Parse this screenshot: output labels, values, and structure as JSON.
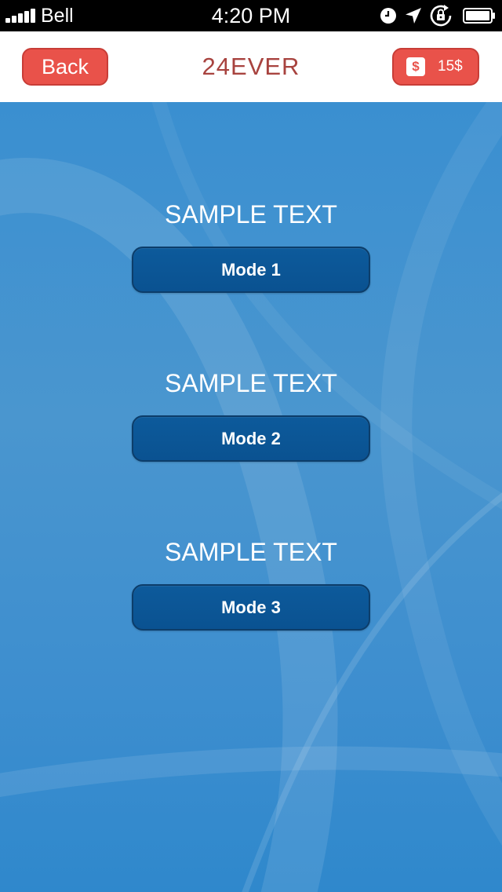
{
  "status_bar": {
    "carrier": "Bell",
    "time": "4:20 PM",
    "icons": [
      "signal-icon",
      "clock-icon",
      "location-arrow-icon",
      "rotation-lock-icon",
      "battery-icon"
    ]
  },
  "nav": {
    "back_label": "Back",
    "title": "24EVER",
    "coins_symbol": "$",
    "coins_amount": "15$"
  },
  "sections": [
    {
      "heading": "SAMPLE TEXT",
      "button_label": "Mode 1"
    },
    {
      "heading": "SAMPLE TEXT",
      "button_label": "Mode 2"
    },
    {
      "heading": "SAMPLE TEXT",
      "button_label": "Mode 3"
    }
  ],
  "colors": {
    "accent_red": "#e9524a",
    "title_red": "#a8433f",
    "mode_button": "#0a5291",
    "background_blue": "#3a8fd0"
  }
}
